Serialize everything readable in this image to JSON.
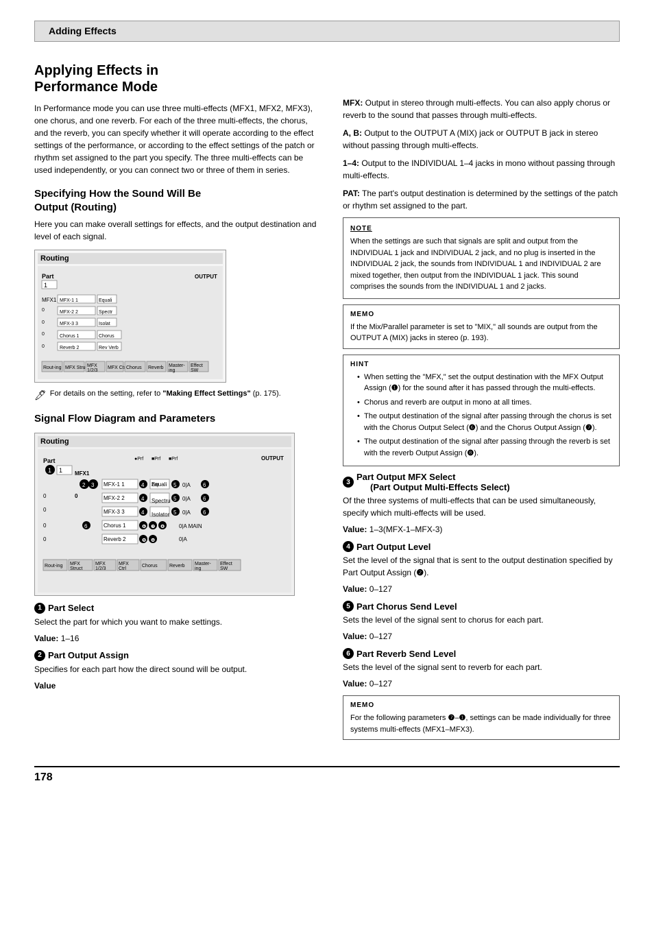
{
  "header": {
    "section": "Adding Effects"
  },
  "page_number": "178",
  "main_title": "Applying Effects in\nPerformance Mode",
  "intro_text": "In Performance mode you can use three multi-effects (MFX1, MFX2, MFX3), one chorus, and one reverb. For each of the three multi-effects, the chorus, and the reverb, you can specify whether it will operate according to the effect settings of the performance, or according to the effect settings of the patch or rhythm set assigned to the part you specify. The three multi-effects can be used independently, or you can connect two or three of them in series.",
  "section1": {
    "title": "Specifying How the Sound Will Be Output (Routing)",
    "body": "Here you can make overall settings for effects, and the output destination and level of each signal.",
    "ref_note": "For details on the setting, refer to \"Making Effect Settings\" (p. 175)."
  },
  "section2": {
    "title": "Signal Flow Diagram and Parameters"
  },
  "subsections": [
    {
      "num": "1",
      "title": "Part Select",
      "body": "Select the part for which you want to make settings.",
      "value_label": "Value:",
      "value": "1–16"
    },
    {
      "num": "2",
      "title": "Part Output Assign",
      "body": "Specifies for each part how the direct sound will be output.",
      "value_label": "Value",
      "value": ""
    },
    {
      "num": "3",
      "title": "Part Output MFX Select\n(Part Output Multi-Effects Select)",
      "body": "Of the three systems of multi-effects that can be used simultaneously, specify which multi-effects will be used.",
      "value_label": "Value:",
      "value": "1–3(MFX-1–MFX-3)"
    },
    {
      "num": "4",
      "title": "Part Output Level",
      "body": "Set the level of the signal that is sent to the output destination specified by Part Output Assign (❷).",
      "value_label": "Value:",
      "value": "0–127"
    },
    {
      "num": "5",
      "title": "Part Chorus Send Level",
      "body": "Sets the level of the signal sent to chorus for each part.",
      "value_label": "Value:",
      "value": "0–127"
    },
    {
      "num": "6",
      "title": "Part Reverb Send Level",
      "body": "Sets the level of the signal sent to reverb for each part.",
      "value_label": "Value:",
      "value": "0–127"
    }
  ],
  "right_col": {
    "def_items": [
      {
        "term": "MFX:",
        "desc": "Output in stereo through multi-effects. You can also apply chorus or reverb to the sound that passes through multi-effects."
      },
      {
        "term": "A, B:",
        "desc": "Output to the OUTPUT A (MIX) jack or OUTPUT B jack in stereo without passing through multi-effects."
      },
      {
        "term": "1–4:",
        "desc": "Output to the INDIVIDUAL 1–4 jacks in mono without passing through multi-effects."
      },
      {
        "term": "PAT:",
        "desc": "The part's output destination is determined by the settings of the patch or rhythm set assigned to the part."
      }
    ],
    "note_box": {
      "label": "NOTE",
      "text": "When the settings are such that signals are split and output from the INDIVIDUAL 1 jack and INDIVIDUAL 2 jack, and no plug is inserted in the INDIVIDUAL 2 jack, the sounds from INDIVIDUAL 1 and INDIVIDUAL 2 are mixed together, then output from the INDIVIDUAL 1 jack. This sound comprises the sounds from the INDIVIDUAL 1 and 2 jacks."
    },
    "memo_box": {
      "label": "MEMO",
      "text": "If the Mix/Parallel parameter is set to \"MIX,\" all sounds are output from the OUTPUT A (MIX) jacks in stereo (p. 193)."
    },
    "hint_box": {
      "label": "HINT",
      "bullets": [
        "When setting the \"MFX,\" set the output destination with the MFX Output Assign (❶) for the sound after it has passed through the multi-effects.",
        "Chorus and reverb are output in mono at all times.",
        "The output destination of the signal after passing through the chorus is set with the Chorus Output Select (❻) and the Chorus Output Assign (❼).",
        "The output destination of the signal after passing through the reverb is set with the reverb Output Assign (❽)."
      ]
    },
    "sub_section3_extra": {
      "title_part3": "❸ Part Output MFX Select\n(Part Output Multi-Effects Select)",
      "title_part4": "❹ Part Output Level",
      "title_part5": "❺ Part Chorus Send Level",
      "title_part6": "❻ Part Reverb Send Level"
    },
    "memo_bottom": {
      "label": "MEMO",
      "text": "For the following parameters ❼–❶, settings can be made individually for three systems multi-effects (MFX1–MFX3)."
    }
  }
}
